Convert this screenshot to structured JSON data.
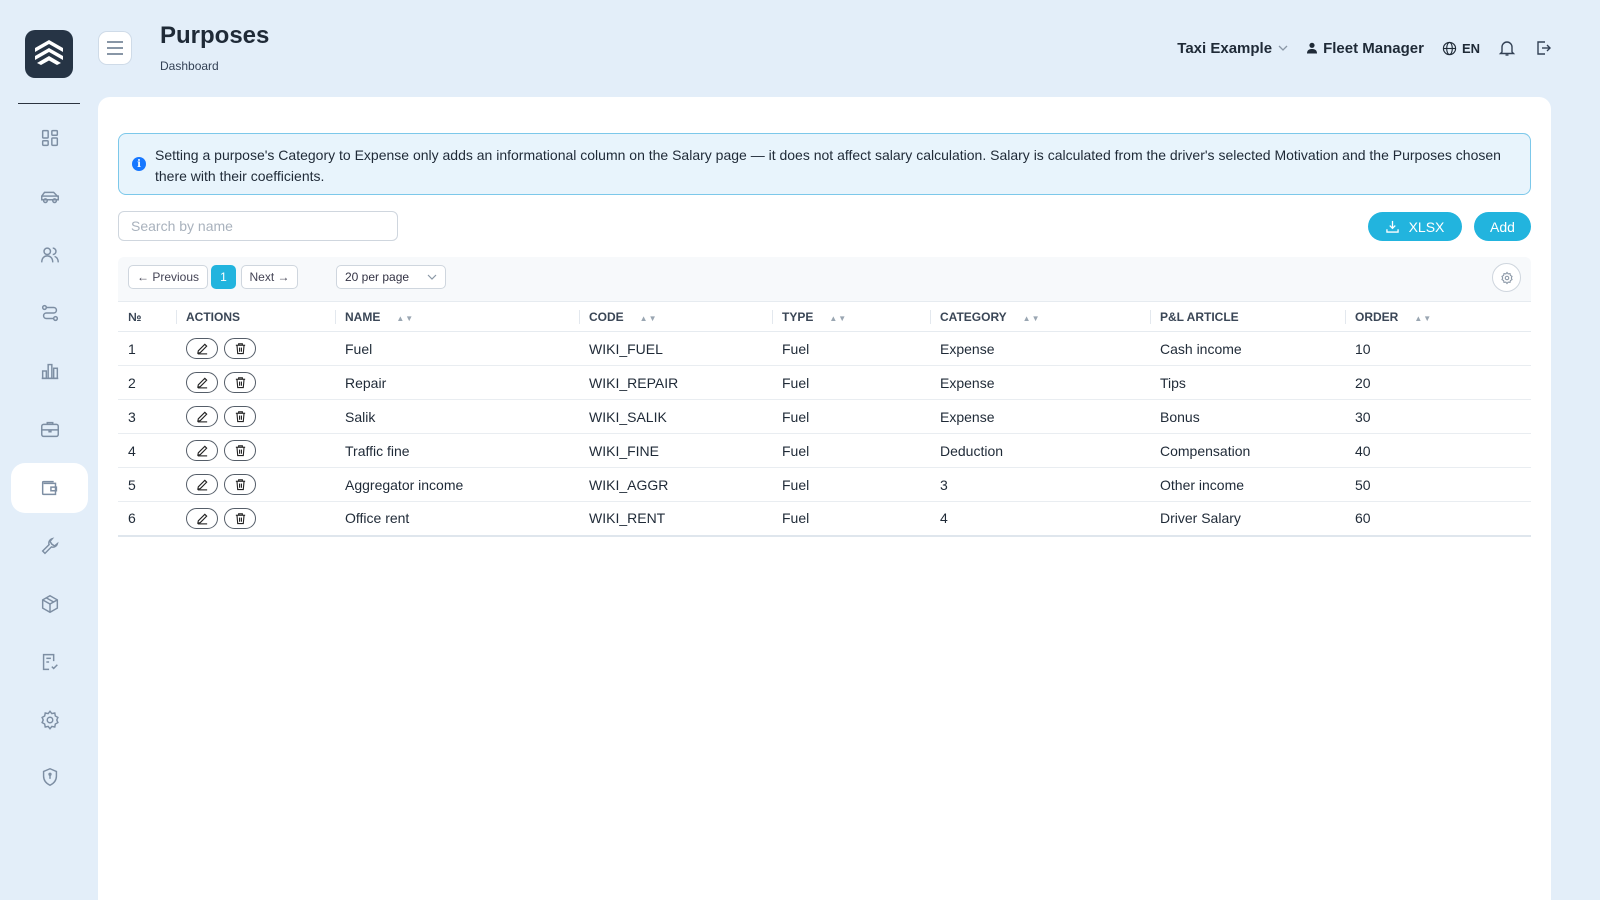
{
  "header": {
    "title": "Purposes",
    "breadcrumb": "Dashboard",
    "company": "Taxi Example",
    "user": "Fleet Manager",
    "language": "EN"
  },
  "sidebar": {
    "items": [
      {
        "icon": "dashboard-icon"
      },
      {
        "icon": "car-icon"
      },
      {
        "icon": "users-icon"
      },
      {
        "icon": "route-icon"
      },
      {
        "icon": "chart-icon"
      },
      {
        "icon": "briefcase-icon"
      },
      {
        "icon": "wallet-icon",
        "active": true
      },
      {
        "icon": "wrench-icon"
      },
      {
        "icon": "box-icon"
      },
      {
        "icon": "checklist-icon"
      },
      {
        "icon": "gear-icon"
      },
      {
        "icon": "shield-icon"
      }
    ]
  },
  "info": {
    "text": "Setting a purpose's Category to Expense only adds an informational column on the Salary page — it does not affect salary calculation. Salary is calculated from the driver's selected Motivation and the Purposes chosen there with their coefficients."
  },
  "search": {
    "placeholder": "Search by name",
    "value": ""
  },
  "toolbar": {
    "xlsx_label": "XLSX",
    "add_label": "Add"
  },
  "pager": {
    "prev_label": "← Previous",
    "next_label": "Next →",
    "current_page": "1",
    "per_page": "20 per page"
  },
  "table": {
    "columns": [
      "№",
      "Actions",
      "Name",
      "Code",
      "Type",
      "Category",
      "P&L Article",
      "Order"
    ],
    "rows": [
      [
        "1",
        "Fuel",
        "WIKI_FUEL",
        "Fuel",
        "Expense",
        "Cash income",
        "10"
      ],
      [
        "2",
        "Repair",
        "WIKI_REPAIR",
        "Fuel",
        "Expense",
        "Tips",
        "20"
      ],
      [
        "3",
        "Salik",
        "WIKI_SALIK",
        "Fuel",
        "Expense",
        "Bonus",
        "30"
      ],
      [
        "4",
        "Traffic fine",
        "WIKI_FINE",
        "Fuel",
        "Deduction",
        "Compensation",
        "40"
      ],
      [
        "5",
        "Aggregator income",
        "WIKI_AGGR",
        "Fuel",
        "3",
        "Other income",
        "50"
      ],
      [
        "6",
        "Office rent",
        "WIKI_RENT",
        "Fuel",
        "4",
        "Driver Salary",
        "60"
      ]
    ]
  },
  "colors": {
    "accent": "#22b4de",
    "info_border": "#7cc8ea",
    "info_bg": "#e8f4fc",
    "page_bg": "#e3eef9"
  }
}
